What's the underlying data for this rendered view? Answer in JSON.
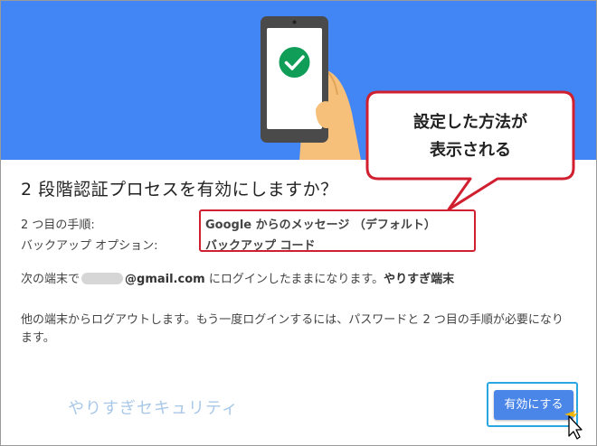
{
  "dialog": {
    "title": "2 段階認証プロセスを有効にしますか？",
    "options": [
      {
        "label": "2 つ目の手順:",
        "value": "Google からのメッセージ （デフォルト）"
      },
      {
        "label": "バックアップ オプション:",
        "value": "バックアップ コード"
      }
    ],
    "device_notice": {
      "prefix": "次の端末で",
      "email_suffix": "@gmail.com",
      "middle": " にログインしたままになります。",
      "device_name": "やりすぎ端末"
    },
    "logout_notice": "他の端末からログアウトします。もう一度ログインするには、パスワードと 2 つ目の手順が必要になります。",
    "enable_button": "有効にする"
  },
  "callout": {
    "line1": "設定した方法が",
    "line2": "表示される"
  },
  "watermark": "やりすぎセキュリティ",
  "colors": {
    "hero_blue": "#4285f4",
    "button_blue": "#4a86e8",
    "callout_border": "#d01f2f",
    "check_green": "#0f9d58",
    "hand_skin": "#f6c07a"
  },
  "icons": {
    "hero": "phone-check-icon",
    "cursor": "pointer-cursor-icon"
  }
}
